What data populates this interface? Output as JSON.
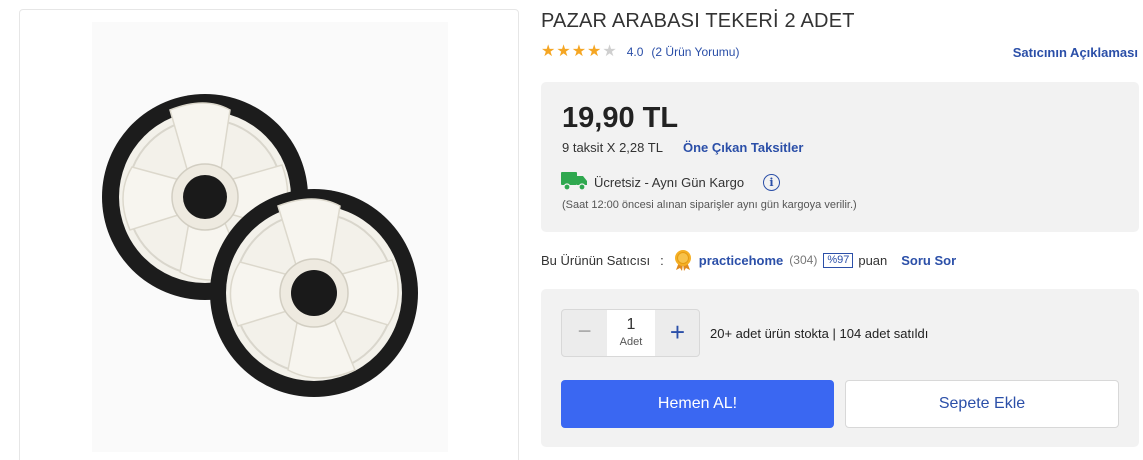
{
  "product": {
    "title": "PAZAR ARABASI TEKERİ 2 ADET",
    "image_alt": "wheel-pair-photo"
  },
  "rating": {
    "stars_filled": 4,
    "stars_total": 5,
    "value": "4.0",
    "review_count": "(2 Ürün Yorumu)"
  },
  "seller_description_link": "Satıcının Açıklaması",
  "price": {
    "amount": "19,90 TL",
    "installment": "9 taksit X 2,28 TL",
    "installment_link": "Öne Çıkan Taksitler"
  },
  "shipping": {
    "text": "Ücretsiz - Aynı Gün Kargo",
    "note": "(Saat 12:00 öncesi alınan siparişler aynı gün kargoya verilir.)",
    "icon": "truck-icon",
    "info_icon_glyph": "i"
  },
  "seller": {
    "label": "Bu Ürünün Satıcısı",
    "colon": ":",
    "name": "practicehome",
    "count": "(304)",
    "score": "%97",
    "score_unit": "puan",
    "ask_link": "Soru Sor"
  },
  "purchase": {
    "quantity": "1",
    "quantity_unit": "Adet",
    "minus_glyph": "−",
    "plus_glyph": "+",
    "stock_text": "20+ adet ürün stokta | 104 adet satıldı",
    "buy_now_label": "Hemen AL!",
    "add_to_cart_label": "Sepete Ekle"
  },
  "colors": {
    "accent_blue": "#3a67f2",
    "link_blue": "#2b4fa8",
    "star_orange": "#f5a623",
    "star_gray": "#cfcfcf",
    "shipping_green": "#2fa84f"
  }
}
